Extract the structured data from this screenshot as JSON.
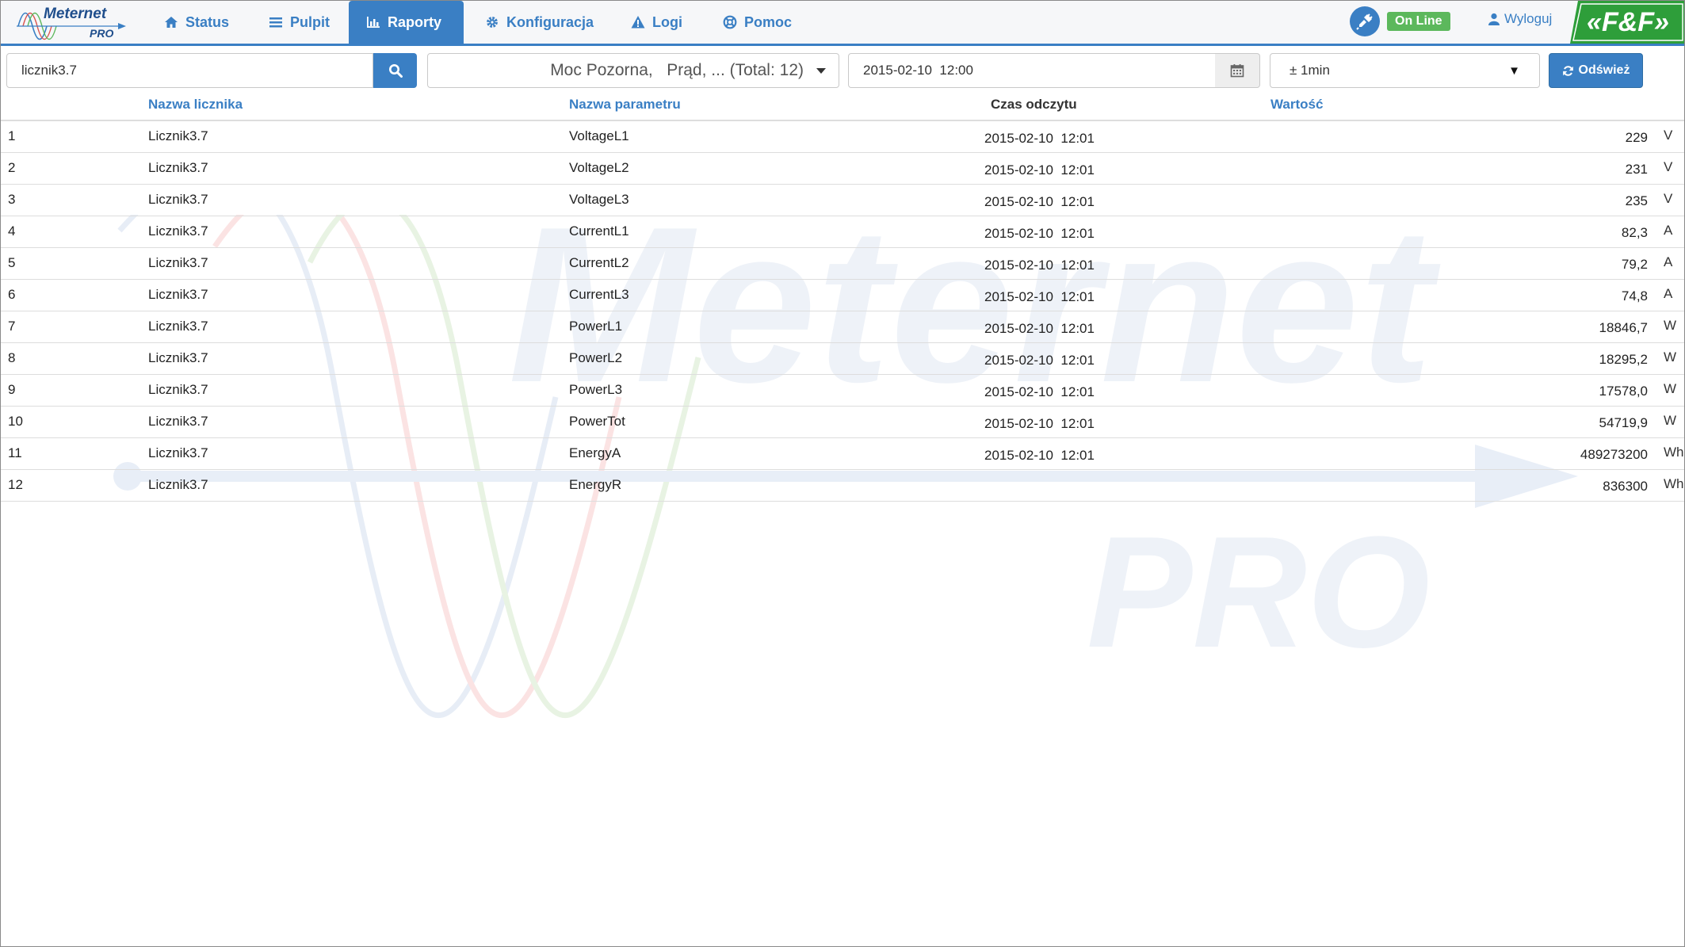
{
  "brand": {
    "name": "Meternet",
    "sub": "PRO"
  },
  "nav": {
    "tabs": [
      {
        "label": "Status",
        "icon": "home-icon"
      },
      {
        "label": "Pulpit",
        "icon": "list-icon"
      },
      {
        "label": "Raporty",
        "icon": "bar-chart-icon",
        "active": true
      },
      {
        "label": "Konfiguracja",
        "icon": "gear-icon"
      },
      {
        "label": "Logi",
        "icon": "warning-icon"
      },
      {
        "label": "Pomoc",
        "icon": "lifebuoy-icon"
      }
    ],
    "status": "On Line",
    "logout": "Wyloguj",
    "vendor_logo": "«F&F»"
  },
  "toolbar": {
    "search_value": "licznik3.7",
    "param_select": "Moc Pozorna,   Prąd, ... (Total: 12)",
    "date_value": "2015-02-10  12:00",
    "range_value": "± 1min",
    "refresh_label": "Odśwież"
  },
  "table": {
    "headers": {
      "meter": "Nazwa licznika",
      "param": "Nazwa parametru",
      "time": "Czas odczytu",
      "value": "Wartość"
    },
    "rows": [
      {
        "idx": "1",
        "meter": "Licznik3.7",
        "param": "VoltageL1",
        "time": "2015-02-10  12:01",
        "value": "229",
        "unit": "V"
      },
      {
        "idx": "2",
        "meter": "Licznik3.7",
        "param": "VoltageL2",
        "time": "2015-02-10  12:01",
        "value": "231",
        "unit": "V"
      },
      {
        "idx": "3",
        "meter": "Licznik3.7",
        "param": "VoltageL3",
        "time": "2015-02-10  12:01",
        "value": "235",
        "unit": "V"
      },
      {
        "idx": "4",
        "meter": "Licznik3.7",
        "param": "CurrentL1",
        "time": "2015-02-10  12:01",
        "value": "82,3",
        "unit": "A"
      },
      {
        "idx": "5",
        "meter": "Licznik3.7",
        "param": "CurrentL2",
        "time": "2015-02-10  12:01",
        "value": "79,2",
        "unit": "A"
      },
      {
        "idx": "6",
        "meter": "Licznik3.7",
        "param": "CurrentL3",
        "time": "2015-02-10  12:01",
        "value": "74,8",
        "unit": "A"
      },
      {
        "idx": "7",
        "meter": "Licznik3.7",
        "param": "PowerL1",
        "time": "2015-02-10  12:01",
        "value": "18846,7",
        "unit": "W"
      },
      {
        "idx": "8",
        "meter": "Licznik3.7",
        "param": "PowerL2",
        "time": "2015-02-10  12:01",
        "value": "18295,2",
        "unit": "W"
      },
      {
        "idx": "9",
        "meter": "Licznik3.7",
        "param": "PowerL3",
        "time": "2015-02-10  12:01",
        "value": "17578,0",
        "unit": "W"
      },
      {
        "idx": "10",
        "meter": "Licznik3.7",
        "param": "PowerTot",
        "time": "2015-02-10  12:01",
        "value": "54719,9",
        "unit": "W"
      },
      {
        "idx": "11",
        "meter": "Licznik3.7",
        "param": "EnergyA",
        "time": "2015-02-10  12:01",
        "value": "489273200",
        "unit": "Wh"
      },
      {
        "idx": "12",
        "meter": "Licznik3.7",
        "param": "EnergyR",
        "time": "",
        "value": "836300",
        "unit": "Wh"
      }
    ]
  },
  "watermark": {
    "word": "Meternet",
    "sub": "PRO"
  },
  "colors": {
    "accent": "#3a7fc4",
    "online": "#5cb85c",
    "vendor": "#2e9e3a"
  }
}
